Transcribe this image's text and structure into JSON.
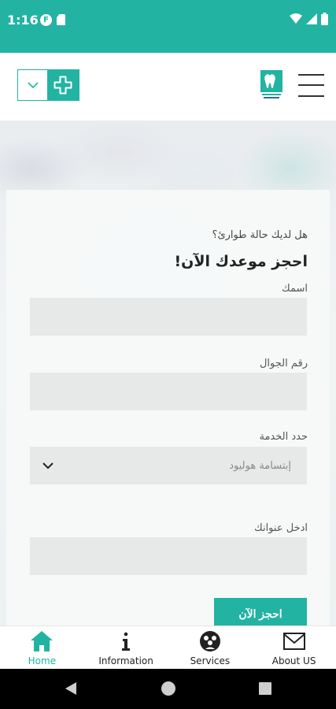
{
  "status_bar": {
    "time": "1:16",
    "icons": [
      "f-notification-icon",
      "sim-card-icon",
      "wifi-icon",
      "signal-icon",
      "battery-icon"
    ],
    "color": "#22b3a3"
  },
  "header": {
    "logo": "dental-clinic-logo",
    "menu_icon": "hamburger-menu-icon",
    "dropdown_icon": "chevron-down-icon",
    "action_icon": "medical-cross-icon"
  },
  "form": {
    "emergency_question": "هل لديك حالة طوارئ؟",
    "title": "احجز موعدك الآن!",
    "name_label": "اسمك",
    "name_value": "",
    "phone_label": "رقم الجوال",
    "phone_value": "",
    "service_label": "حدد الخدمة",
    "service_selected": "إبتسامة هوليود",
    "address_label": "ادخل عنوانك",
    "address_value": "",
    "submit_label": "احجز الآن"
  },
  "bottom_nav": {
    "items": [
      {
        "label": "Home",
        "icon": "home-icon",
        "active": true
      },
      {
        "label": "Information",
        "icon": "info-icon",
        "active": false
      },
      {
        "label": "Services",
        "icon": "services-icon",
        "active": false
      },
      {
        "label": "About US",
        "icon": "mail-icon",
        "active": false
      }
    ]
  },
  "theme": {
    "accent": "#22b3a3",
    "field_bg": "#e7e8e8",
    "text": "#222222"
  }
}
